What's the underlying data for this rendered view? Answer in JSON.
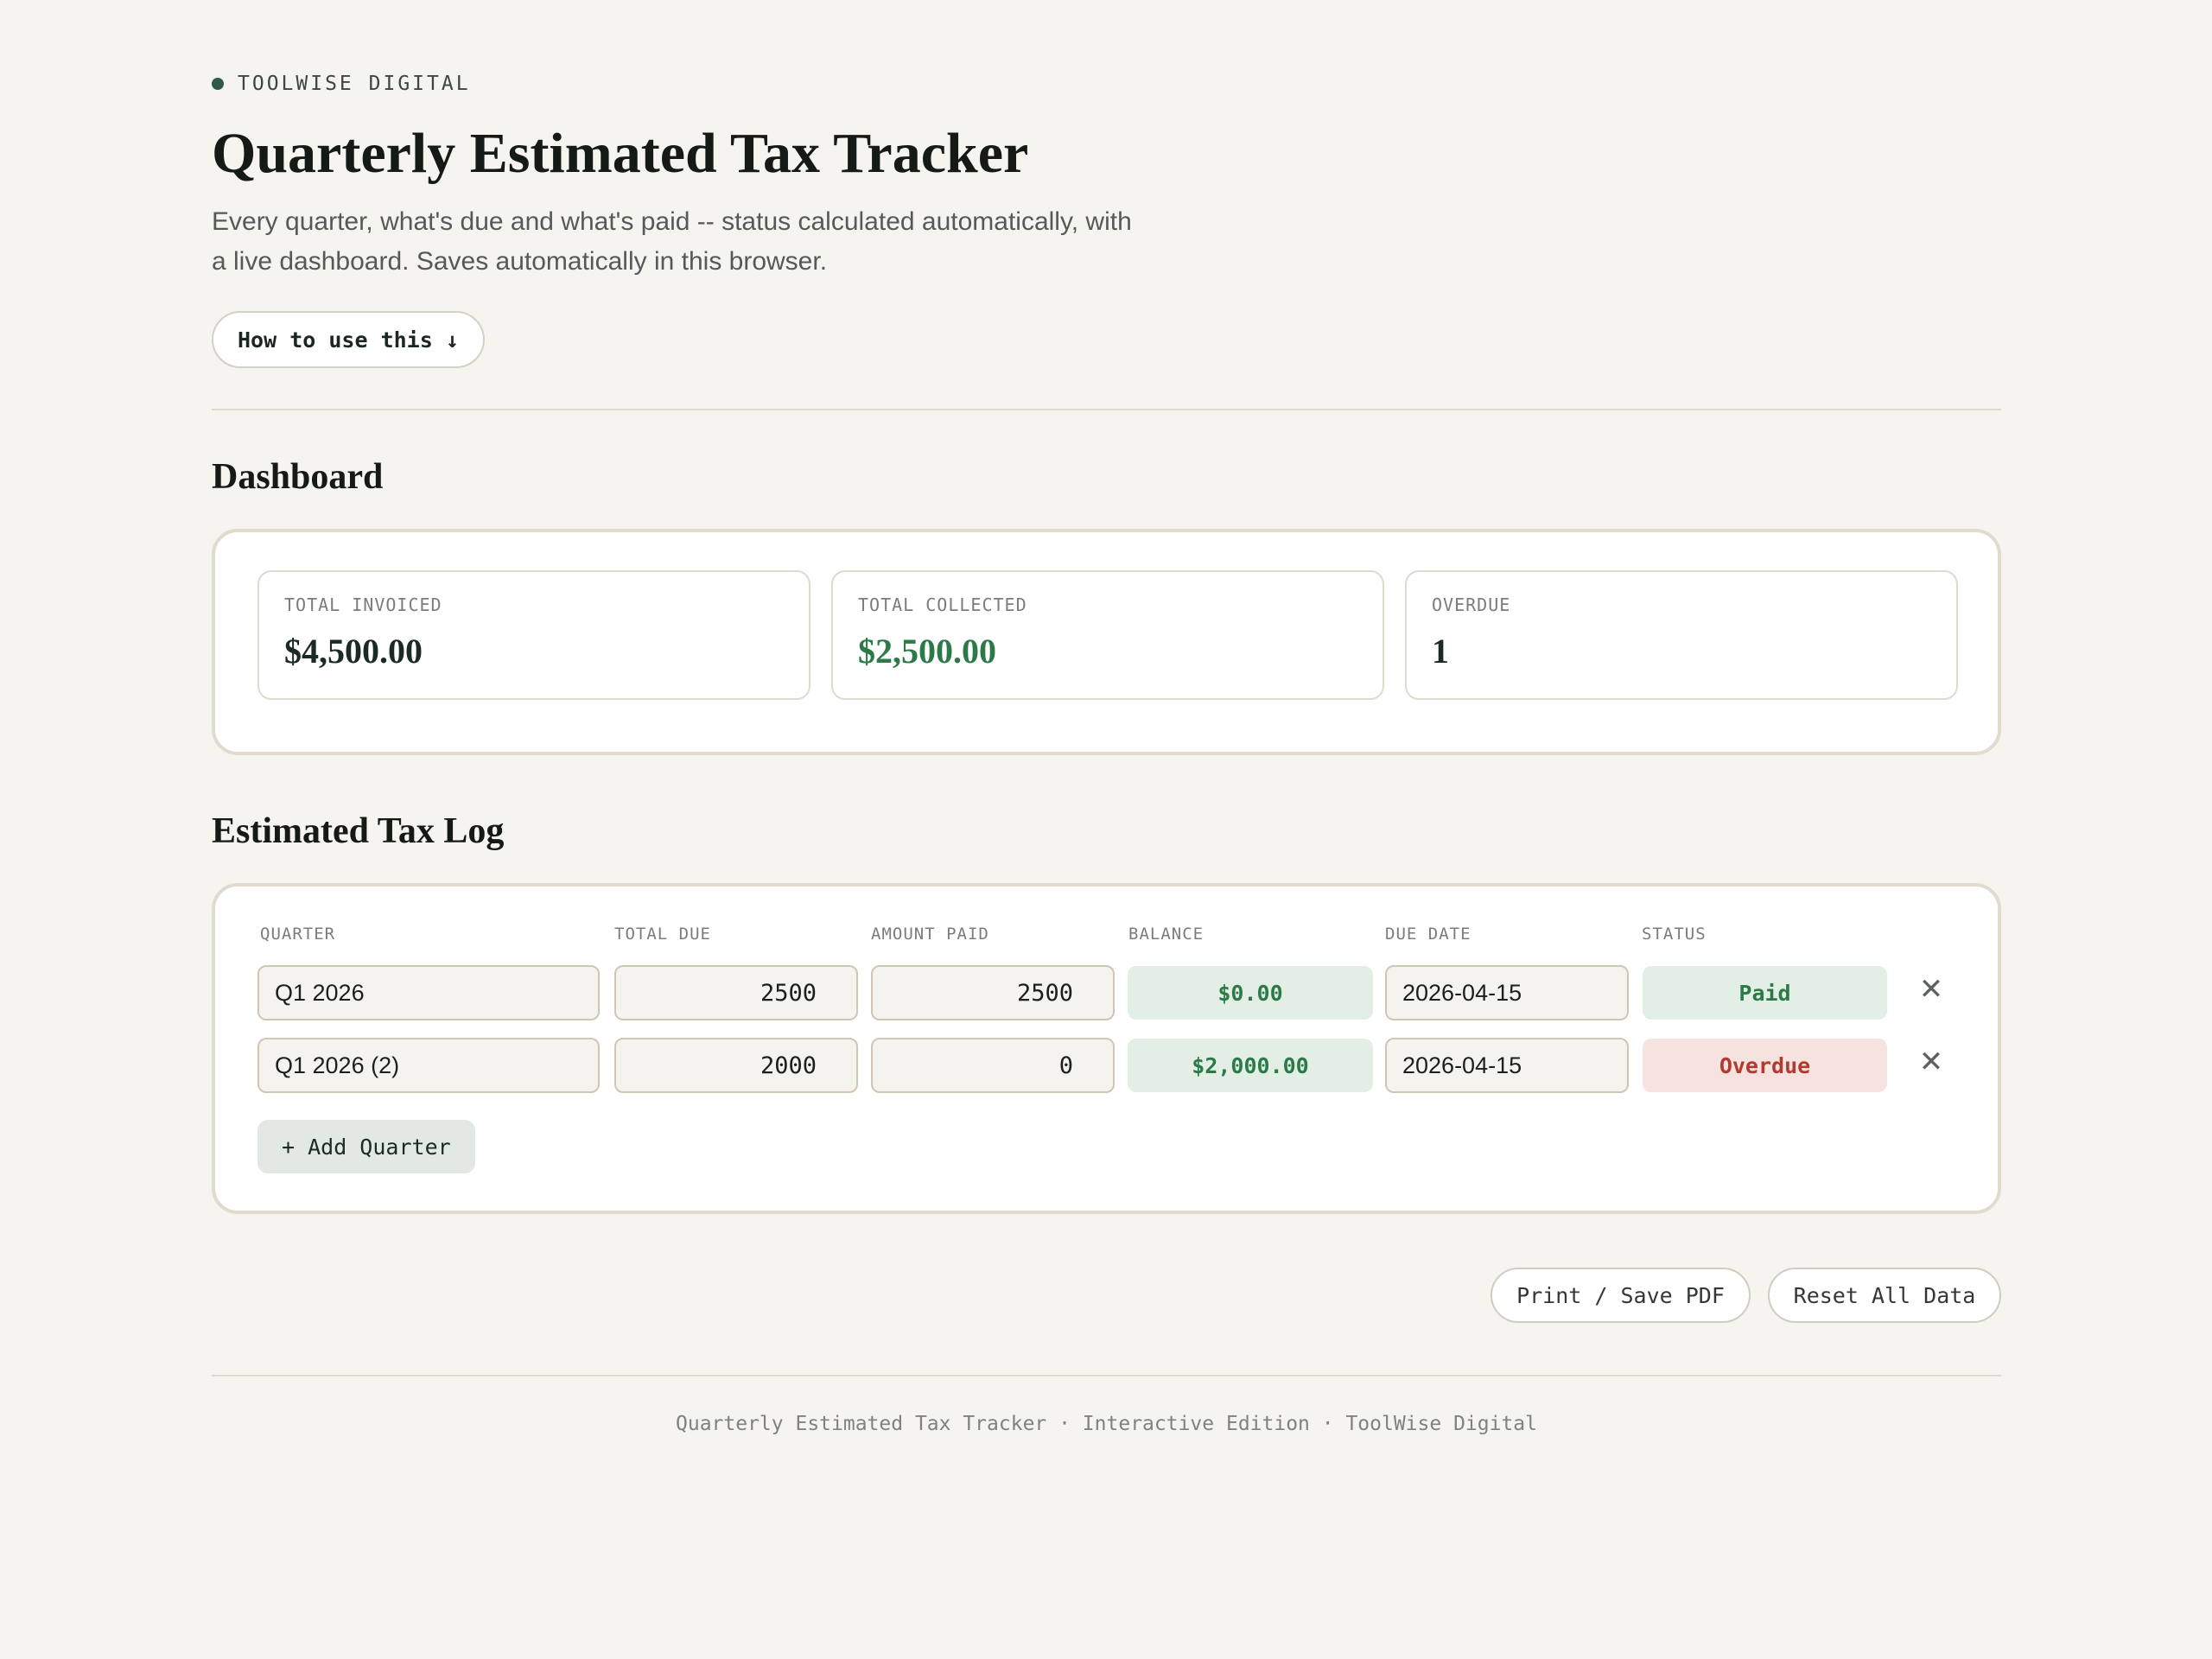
{
  "brand": {
    "name": "TOOLWISE DIGITAL"
  },
  "header": {
    "title": "Quarterly Estimated Tax Tracker",
    "subtitle_line1": "Every quarter, what's due and what's paid -- status calculated automatically, with",
    "subtitle_line2": "a live dashboard. Saves automatically in this browser.",
    "howto_label": "How to use this ↓"
  },
  "dashboard": {
    "title": "Dashboard",
    "stats": [
      {
        "label": "TOTAL INVOICED",
        "value": "$4,500.00"
      },
      {
        "label": "TOTAL COLLECTED",
        "value": "$2,500.00"
      },
      {
        "label": "OVERDUE",
        "value": "1"
      }
    ]
  },
  "log": {
    "title": "Estimated Tax Log",
    "columns": [
      "QUARTER",
      "TOTAL DUE",
      "AMOUNT PAID",
      "BALANCE",
      "DUE DATE",
      "STATUS"
    ],
    "rows": [
      {
        "quarter": "Q1 2026",
        "total_due": "2500",
        "amount_paid": "2500",
        "balance": "$0.00",
        "due_date": "2026-04-15",
        "status": "Paid",
        "remove": "✕"
      },
      {
        "quarter": "Q1 2026 (2)",
        "total_due": "2000",
        "amount_paid": "0",
        "balance": "$2,000.00",
        "due_date": "2026-04-15",
        "status": "Overdue",
        "remove": "✕"
      }
    ],
    "add_label": "+ Add Quarter"
  },
  "actions": {
    "print_label": "Print / Save PDF",
    "reset_label": "Reset All Data"
  },
  "footer": {
    "text": "Quarterly Estimated Tax Tracker · Interactive Edition · ToolWise Digital"
  },
  "colors": {
    "background": "#f5f4ef",
    "accent_green": "#2b7a48",
    "overdue_red": "#b23a2f",
    "brand_dot": "#2f5a45"
  }
}
